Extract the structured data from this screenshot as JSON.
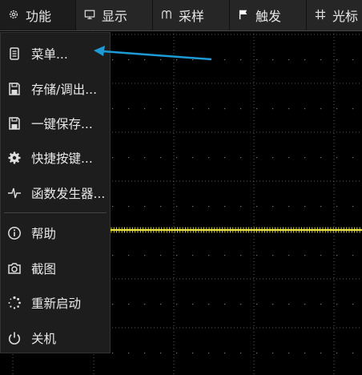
{
  "toolbar": {
    "items": [
      {
        "label": "功能",
        "icon": "gear-icon"
      },
      {
        "label": "显示",
        "icon": "monitor-icon"
      },
      {
        "label": "采样",
        "icon": "sampling-icon"
      },
      {
        "label": "触发",
        "icon": "flag-icon"
      },
      {
        "label": "光标",
        "icon": "crosshair-grid-icon"
      }
    ]
  },
  "menu": {
    "items": [
      {
        "label": "菜单...",
        "icon": "document-icon"
      },
      {
        "label": "存储/调出...",
        "icon": "save-load-icon"
      },
      {
        "label": "一键保存...",
        "icon": "quick-save-icon"
      },
      {
        "label": "快捷按键...",
        "icon": "cog-icon"
      },
      {
        "label": "函数发生器...",
        "icon": "waveform-icon"
      },
      {
        "label": "帮助",
        "icon": "info-icon"
      },
      {
        "label": "截图",
        "icon": "camera-icon"
      },
      {
        "label": "重新启动",
        "icon": "spinner-icon"
      },
      {
        "label": "关机",
        "icon": "power-icon"
      }
    ]
  },
  "colors": {
    "background": "#000000",
    "toolbar": "#262626",
    "menu": "#1d1d1d",
    "trace": "#f0e640",
    "grid": "#5a5a5a",
    "arrow": "#1e9ad6"
  }
}
